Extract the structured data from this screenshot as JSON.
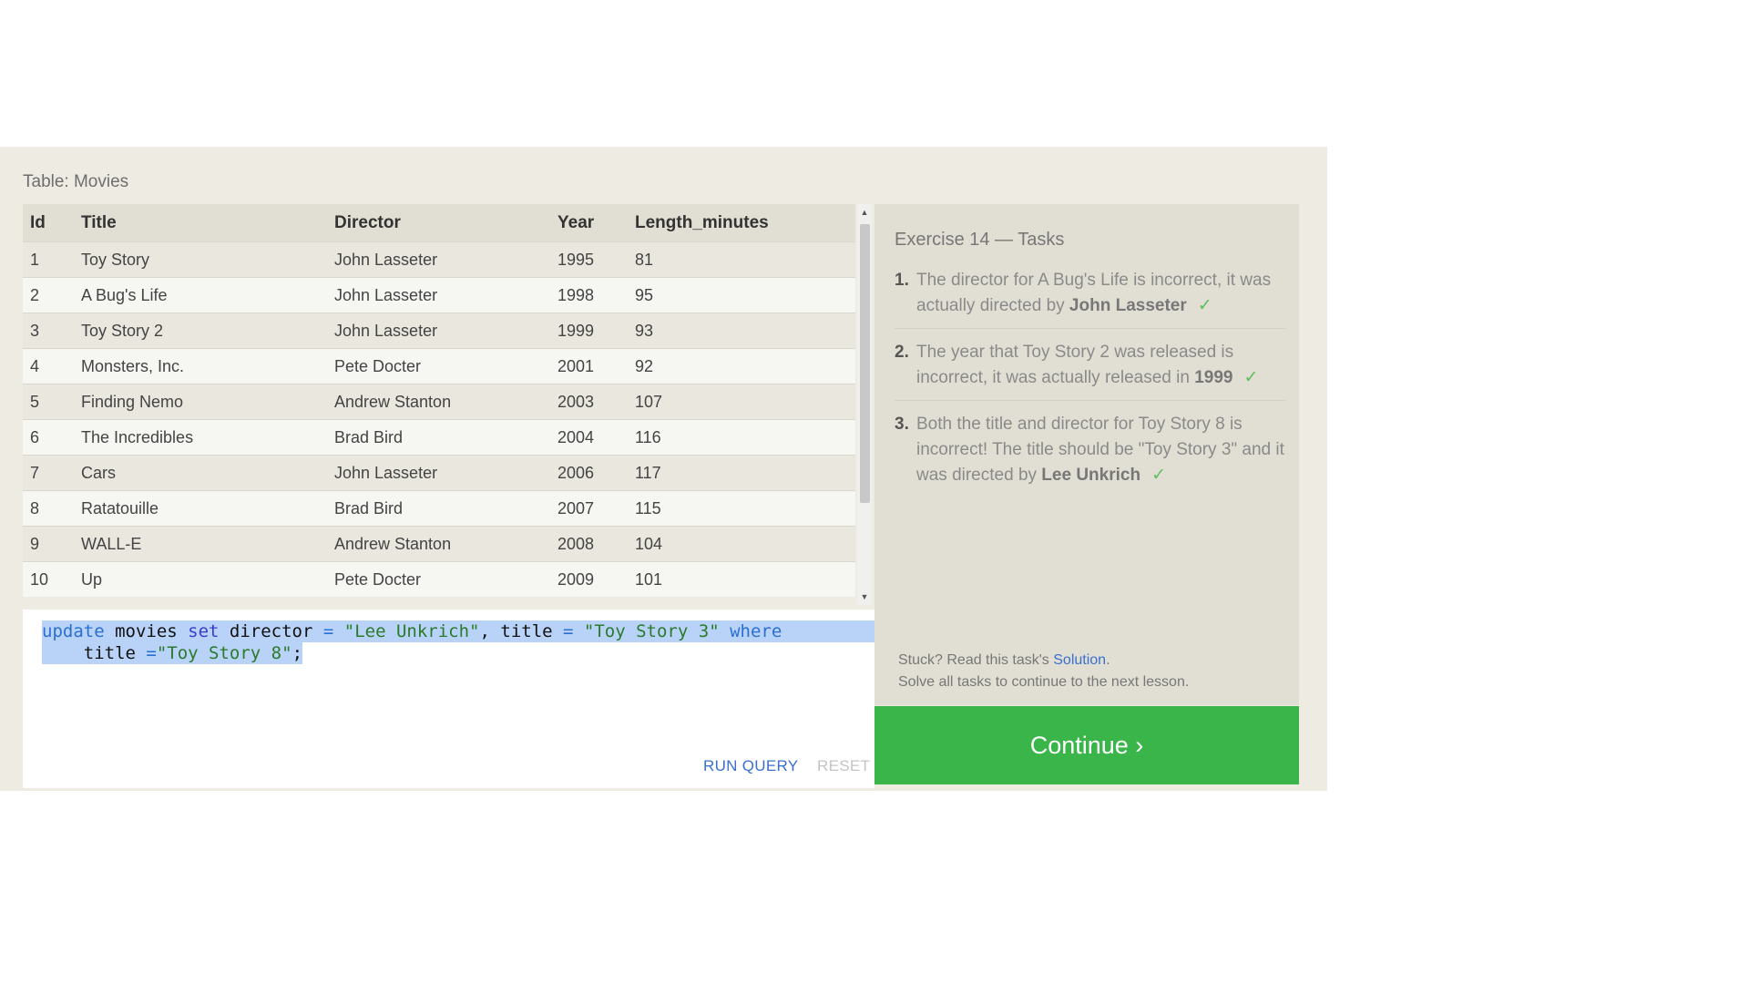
{
  "table_label": "Table: Movies",
  "table": {
    "columns": [
      "Id",
      "Title",
      "Director",
      "Year",
      "Length_minutes"
    ],
    "rows": [
      [
        "1",
        "Toy Story",
        "John Lasseter",
        "1995",
        "81"
      ],
      [
        "2",
        "A Bug's Life",
        "John Lasseter",
        "1998",
        "95"
      ],
      [
        "3",
        "Toy Story 2",
        "John Lasseter",
        "1999",
        "93"
      ],
      [
        "4",
        "Monsters, Inc.",
        "Pete Docter",
        "2001",
        "92"
      ],
      [
        "5",
        "Finding Nemo",
        "Andrew Stanton",
        "2003",
        "107"
      ],
      [
        "6",
        "The Incredibles",
        "Brad Bird",
        "2004",
        "116"
      ],
      [
        "7",
        "Cars",
        "John Lasseter",
        "2006",
        "117"
      ],
      [
        "8",
        "Ratatouille",
        "Brad Bird",
        "2007",
        "115"
      ],
      [
        "9",
        "WALL-E",
        "Andrew Stanton",
        "2008",
        "104"
      ],
      [
        "10",
        "Up",
        "Pete Docter",
        "2009",
        "101"
      ]
    ]
  },
  "editor": {
    "line1": {
      "t1": "update",
      "t2": " movies ",
      "t3": "set",
      "t4": " director ",
      "t5": "=",
      "t6": " ",
      "t7": "\"Lee Unkrich\"",
      "t8": ", title ",
      "t9": "=",
      "t10": " ",
      "t11": "\"Toy Story 3\"",
      "t12": " ",
      "t13": "where"
    },
    "line2": {
      "t1": "    title ",
      "t2": "=",
      "t3": "\"Toy Story 8\"",
      "t4": ";"
    }
  },
  "buttons": {
    "run_query": "RUN QUERY",
    "reset": "RESET",
    "continue": "Continue ›"
  },
  "tasks": {
    "title": "Exercise 14 — Tasks",
    "items": [
      {
        "num": "1.",
        "pre": "The director for A Bug's Life is incorrect, it was actually directed by ",
        "bold": "John Lasseter",
        "check": "✓"
      },
      {
        "num": "2.",
        "pre": "The year that Toy Story 2 was released is incorrect, it was actually released in ",
        "bold": "1999",
        "check": "✓"
      },
      {
        "num": "3.",
        "pre": "Both the title and director for Toy Story 8 is incorrect! The title should be \"Toy Story 3\" and it was directed by ",
        "bold": "Lee Unkrich",
        "check": "✓"
      }
    ],
    "stuck_pre": "Stuck? Read this task's ",
    "solution_link": "Solution",
    "stuck_post": ".",
    "solve_all": "Solve all tasks to continue to the next lesson."
  },
  "colors": {
    "panel_bg": "#eeebe3",
    "tasks_bg": "#e1ded3",
    "continue_bg": "#3ab54a",
    "link": "#3a6fd0",
    "check": "#5cc05c",
    "selection": "#b8d3f7"
  }
}
